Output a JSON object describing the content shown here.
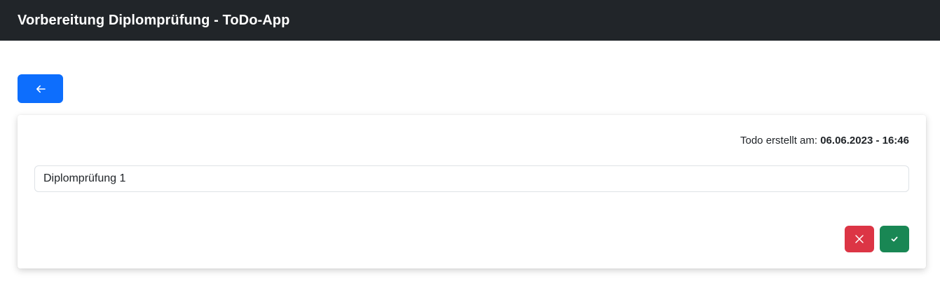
{
  "header": {
    "title": "Vorbereitung Diplomprüfung - ToDo-App"
  },
  "toolbar": {
    "back_icon": "arrow-left-icon"
  },
  "todo": {
    "created_label": "Todo erstellt am:",
    "created_value": "06.06.2023 - 16:46",
    "title_value": "Diplomprüfung 1"
  },
  "actions": {
    "cancel_icon": "x-icon",
    "save_icon": "check-icon"
  },
  "colors": {
    "navbar": "#212529",
    "primary": "#0d6efd",
    "danger": "#dc3545",
    "success": "#198754"
  }
}
